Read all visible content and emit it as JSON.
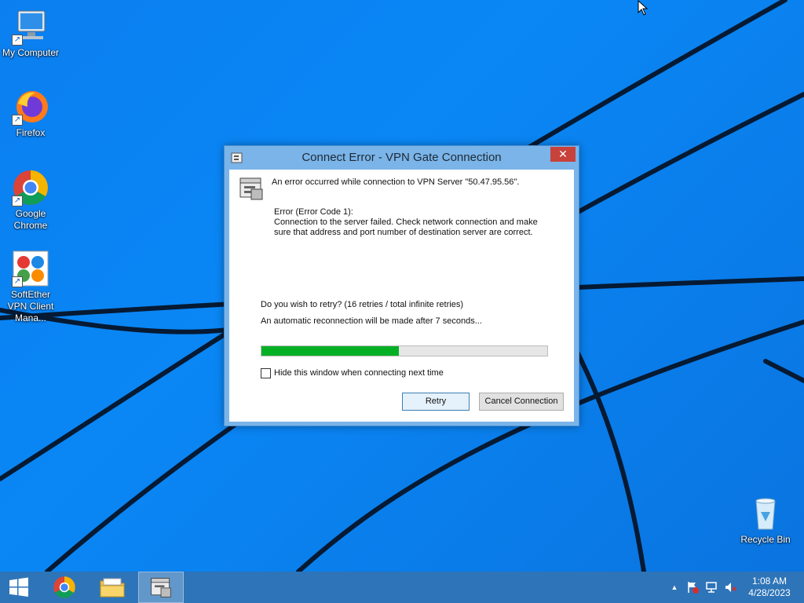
{
  "desktop": {
    "icons": [
      {
        "label": "My Computer",
        "icon": "computer-icon"
      },
      {
        "label": "Firefox",
        "icon": "firefox-icon"
      },
      {
        "label": "Google Chrome",
        "icon": "chrome-icon"
      },
      {
        "label": "SoftEther VPN Client Mana...",
        "icon": "softether-icon"
      },
      {
        "label": "Recycle Bin",
        "icon": "recycle-bin-icon"
      }
    ]
  },
  "dialog": {
    "title": "Connect Error - VPN Gate Connection",
    "close_label": "✕",
    "message": "An error occurred while connection to VPN Server \"50.47.95.56\".",
    "error_title": "Error (Error Code 1):",
    "error_detail": "Connection to the server failed. Check network connection and make sure that address and port number of destination server are correct.",
    "retry_question": "Do you wish to retry? (16 retries / total infinite retries)",
    "auto_reconnect": "An automatic reconnection will be made after 7 seconds...",
    "progress_fraction": 0.48,
    "checkbox_label": "Hide this window when connecting next time",
    "checkbox_checked": false,
    "retry_button": "Retry",
    "cancel_button": "Cancel Connection"
  },
  "taskbar": {
    "items": [
      "start-icon",
      "chrome-icon",
      "file-explorer-icon",
      "softether-icon"
    ],
    "clock_time": "1:08 AM",
    "clock_date": "4/28/2023",
    "tray_expand": "▲"
  },
  "colors": {
    "progress_fill": "#06b025",
    "close_button": "#c7423b",
    "taskbar": "#2e74b8"
  }
}
